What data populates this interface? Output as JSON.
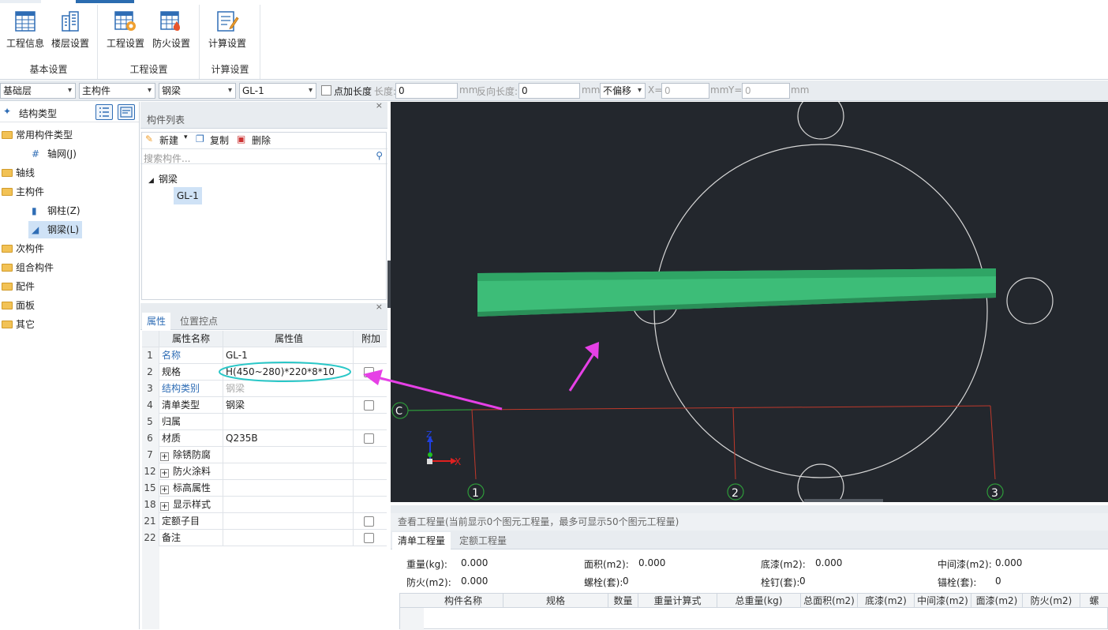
{
  "ribbon": {
    "groups": [
      {
        "title": "基本设置",
        "buttons": [
          {
            "label": "工程信息",
            "icon": "table-icon"
          },
          {
            "label": "楼层设置",
            "icon": "building-icon"
          }
        ]
      },
      {
        "title": "工程设置",
        "buttons": [
          {
            "label": "工程设置",
            "icon": "gear-table-icon"
          },
          {
            "label": "防火设置",
            "icon": "fire-table-icon"
          }
        ]
      },
      {
        "title": "计算设置",
        "buttons": [
          {
            "label": "计算设置",
            "icon": "edit-sheet-icon"
          }
        ]
      }
    ]
  },
  "toolbar": {
    "floor": "基础层",
    "category": "主构件",
    "type": "钢梁",
    "component": "GL-1",
    "point_length_label": "点加长度",
    "length_label": "长度:",
    "length_value": "0",
    "mm1": "mm",
    "reverse_label": "反向长度:",
    "reverse_value": "0",
    "mm2": "mm",
    "offset": "不偏移",
    "x_label": "X=",
    "x_value": "0",
    "mm3": "mm",
    "y_label": "Y=",
    "y_value": "0",
    "mm4": "mm"
  },
  "tree": {
    "title": "结构类型",
    "items": [
      {
        "label": "常用构件类型",
        "level": 0
      },
      {
        "label": "轴网(J)",
        "level": 1
      },
      {
        "label": "轴线",
        "level": 0
      },
      {
        "label": "主构件",
        "level": 0
      },
      {
        "label": "钢柱(Z)",
        "level": 1
      },
      {
        "label": "钢梁(L)",
        "level": 1
      },
      {
        "label": "次构件",
        "level": 0
      },
      {
        "label": "组合构件",
        "level": 0
      },
      {
        "label": "配件",
        "level": 0
      },
      {
        "label": "面板",
        "level": 0
      },
      {
        "label": "其它",
        "level": 0
      }
    ]
  },
  "component_list": {
    "title": "构件列表",
    "new_label": "新建",
    "copy_label": "复制",
    "delete_label": "删除",
    "search_placeholder": "搜索构件...",
    "group": "钢梁",
    "item": "GL-1"
  },
  "properties": {
    "tabs": [
      "属性",
      "位置控点"
    ],
    "headers": [
      "属性名称",
      "属性值",
      "附加"
    ],
    "rows": [
      {
        "no": "1",
        "name": "名称",
        "value": "GL-1",
        "blue": true,
        "check": false,
        "expand": false,
        "grey": false
      },
      {
        "no": "2",
        "name": "规格",
        "value": "H(450~280)*220*8*10",
        "blue": false,
        "check": true,
        "expand": false,
        "grey": false
      },
      {
        "no": "3",
        "name": "结构类别",
        "value": "钢梁",
        "blue": true,
        "check": false,
        "expand": false,
        "grey": true
      },
      {
        "no": "4",
        "name": "清单类型",
        "value": "钢梁",
        "blue": false,
        "check": true,
        "expand": false,
        "grey": false
      },
      {
        "no": "5",
        "name": "归属",
        "value": "",
        "blue": false,
        "check": false,
        "expand": false,
        "grey": false
      },
      {
        "no": "6",
        "name": "材质",
        "value": "Q235B",
        "blue": false,
        "check": true,
        "expand": false,
        "grey": false
      },
      {
        "no": "7",
        "name": "除锈防腐",
        "value": "",
        "blue": false,
        "check": false,
        "expand": true,
        "grey": false
      },
      {
        "no": "12",
        "name": "防火涂料",
        "value": "",
        "blue": false,
        "check": false,
        "expand": true,
        "grey": false
      },
      {
        "no": "15",
        "name": "标高属性",
        "value": "",
        "blue": false,
        "check": false,
        "expand": true,
        "grey": false
      },
      {
        "no": "18",
        "name": "显示样式",
        "value": "",
        "blue": false,
        "check": false,
        "expand": true,
        "grey": false
      },
      {
        "no": "21",
        "name": "定额子目",
        "value": "",
        "blue": false,
        "check": true,
        "expand": false,
        "grey": false
      },
      {
        "no": "22",
        "name": "备注",
        "value": "",
        "blue": false,
        "check": true,
        "expand": false,
        "grey": false
      }
    ]
  },
  "canvas": {
    "axis_c": "C",
    "axis_1": "1",
    "axis_2": "2",
    "axis_3": "3",
    "gizmo_x": "X",
    "gizmo_z": "Z"
  },
  "quantities": {
    "title": "查看工程量(当前显示0个图元工程量，最多可显示50个图元工程量)",
    "tabs": [
      "清单工程量",
      "定额工程量"
    ],
    "stats": [
      {
        "label": "重量(kg):",
        "value": "0.000"
      },
      {
        "label": "面积(m2):",
        "value": "0.000"
      },
      {
        "label": "底漆(m2):",
        "value": "0.000"
      },
      {
        "label": "中间漆(m2):",
        "value": "0.000"
      },
      {
        "label": "防火(m2):",
        "value": "0.000"
      },
      {
        "label": "螺栓(套):",
        "value": "0"
      },
      {
        "label": "栓钉(套):",
        "value": "0"
      },
      {
        "label": "锚栓(套):",
        "value": "0"
      }
    ],
    "columns": [
      "构件名称",
      "规格",
      "数量",
      "重量计算式",
      "总重量(kg)",
      "总面积(m2)",
      "底漆(m2)",
      "中间漆(m2)",
      "面漆(m2)",
      "防火(m2)",
      "螺"
    ]
  },
  "colors": {
    "accent": "#2b6cb0",
    "beam": "#3dbd78",
    "annotation": "#e640e6",
    "highlight_ring": "#29c7c7"
  }
}
